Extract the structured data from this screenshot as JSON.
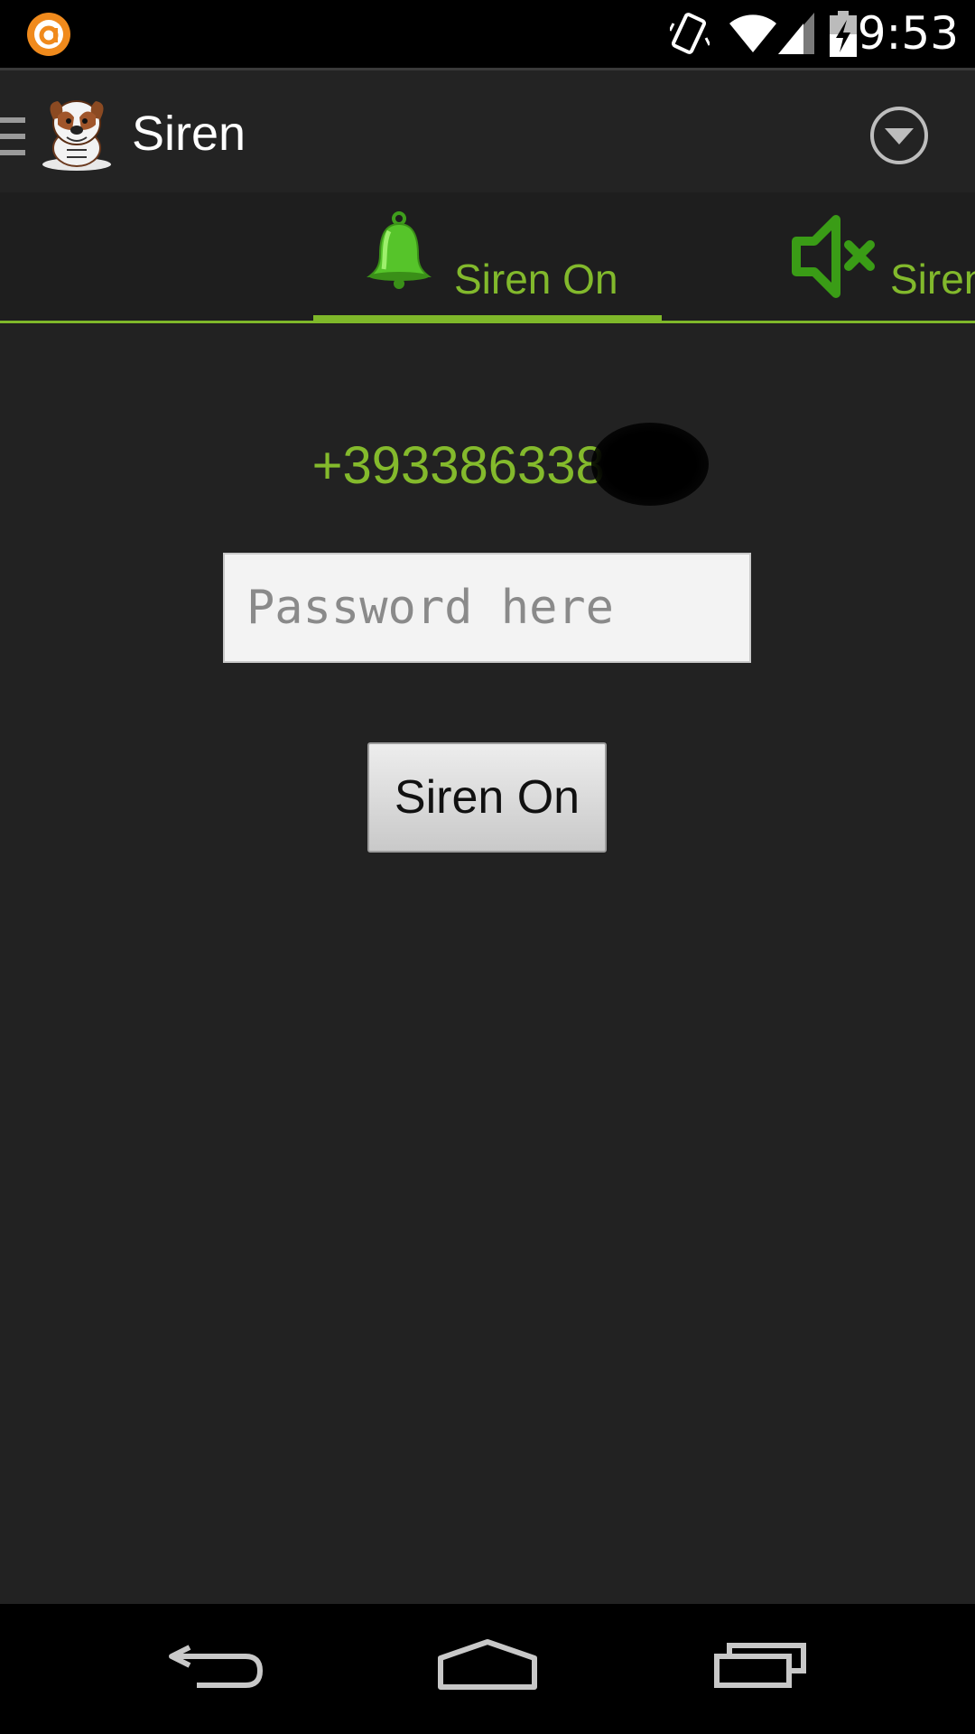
{
  "status_bar": {
    "time": "9:53",
    "icons": [
      "notification-app-icon",
      "vibrate-icon",
      "wifi-icon",
      "signal-icon",
      "battery-charging-icon"
    ]
  },
  "action_bar": {
    "title": "Siren",
    "icons": [
      "drawer-menu-icon",
      "bulldog-logo-icon",
      "overflow-dropdown-icon"
    ]
  },
  "tabs": [
    {
      "label": "Siren On",
      "icon": "bell-icon",
      "active": true
    },
    {
      "label": "Siren",
      "icon": "speaker-mute-icon",
      "active": false
    }
  ],
  "main": {
    "phone_number": "+39338633890",
    "password_placeholder": "Password here",
    "password_value": "",
    "button_label": "Siren On"
  },
  "nav_bar": {
    "icons": [
      "back-icon",
      "home-icon",
      "recents-icon"
    ]
  },
  "colors": {
    "accent": "#7fb82a",
    "background": "#222222",
    "bars": "#000000"
  }
}
